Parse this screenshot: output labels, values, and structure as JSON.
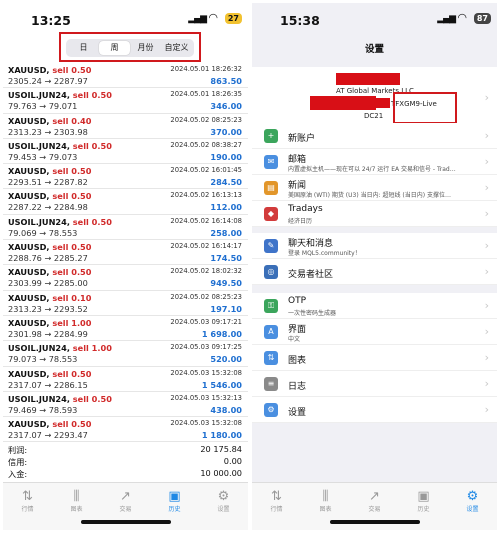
{
  "left": {
    "status": {
      "time": "13:25",
      "battery": "27"
    },
    "segments": [
      "日",
      "周",
      "月份",
      "自定义"
    ],
    "trades": [
      {
        "symbol": "XAUUSD,",
        "side": "sell 0.50",
        "datetime": "2024.05.01 18:26:32",
        "prices": "2305.24 → 2287.97",
        "profit": "863.50"
      },
      {
        "symbol": "USOIL.JUN24,",
        "side": "sell 0.50",
        "datetime": "2024.05.01 18:26:35",
        "prices": "79.763 → 79.071",
        "profit": "346.00"
      },
      {
        "symbol": "XAUUSD,",
        "side": "sell 0.40",
        "datetime": "2024.05.02 08:25:23",
        "prices": "2313.23 → 2303.98",
        "profit": "370.00"
      },
      {
        "symbol": "USOIL.JUN24,",
        "side": "sell 0.50",
        "datetime": "2024.05.02 08:38:27",
        "prices": "79.453 → 79.073",
        "profit": "190.00"
      },
      {
        "symbol": "XAUUSD,",
        "side": "sell 0.50",
        "datetime": "2024.05.02 16:01:45",
        "prices": "2293.51 → 2287.82",
        "profit": "284.50"
      },
      {
        "symbol": "XAUUSD,",
        "side": "sell 0.50",
        "datetime": "2024.05.02 16:13:13",
        "prices": "2287.22 → 2284.98",
        "profit": "112.00"
      },
      {
        "symbol": "USOIL.JUN24,",
        "side": "sell 0.50",
        "datetime": "2024.05.02 16:14:08",
        "prices": "79.069 → 78.553",
        "profit": "258.00"
      },
      {
        "symbol": "XAUUSD,",
        "side": "sell 0.50",
        "datetime": "2024.05.02 16:14:17",
        "prices": "2288.76 → 2285.27",
        "profit": "174.50"
      },
      {
        "symbol": "XAUUSD,",
        "side": "sell 0.50",
        "datetime": "2024.05.02 18:02:32",
        "prices": "2303.99 → 2285.00",
        "profit": "949.50"
      },
      {
        "symbol": "XAUUSD,",
        "side": "sell 0.10",
        "datetime": "2024.05.02 08:25:23",
        "prices": "2313.23 → 2293.52",
        "profit": "197.10"
      },
      {
        "symbol": "XAUUSD,",
        "side": "sell 1.00",
        "datetime": "2024.05.03 09:17:21",
        "prices": "2301.98 → 2284.99",
        "profit": "1 698.00"
      },
      {
        "symbol": "USOIL.JUN24,",
        "side": "sell 1.00",
        "datetime": "2024.05.03 09:17:25",
        "prices": "79.073 → 78.553",
        "profit": "520.00"
      },
      {
        "symbol": "XAUUSD,",
        "side": "sell 0.50",
        "datetime": "2024.05.03 15:32:08",
        "prices": "2317.07 → 2286.15",
        "profit": "1 546.00"
      },
      {
        "symbol": "USOIL.JUN24,",
        "side": "sell 0.50",
        "datetime": "2024.05.03 15:32:13",
        "prices": "79.469 → 78.593",
        "profit": "438.00"
      },
      {
        "symbol": "XAUUSD,",
        "side": "sell 0.50",
        "datetime": "2024.05.03 15:32:08",
        "prices": "2317.07 → 2293.47",
        "profit": "1 180.00"
      }
    ],
    "totals": [
      {
        "label": "利润:",
        "value": "20 175.84"
      },
      {
        "label": "信用:",
        "value": "0.00"
      },
      {
        "label": "入金:",
        "value": "10 000.00"
      }
    ]
  },
  "right": {
    "status": {
      "time": "15:38",
      "battery": "87"
    },
    "title": "设置",
    "account": {
      "broker": "AT Global Markets LLC",
      "server": "TFXGM9-Live",
      "id": "DC21"
    },
    "groups": [
      [
        {
          "label": "新账户",
          "sub": "",
          "icon": "new-account-icon",
          "color": "#3ba55c",
          "glyph": "+"
        },
        {
          "label": "邮箱",
          "sub": "内置虚拟主机——现在可以 24/7 运行 EA 交易和信号 - Trad…",
          "icon": "mail-icon",
          "color": "#4a8fe0",
          "glyph": "✉"
        },
        {
          "label": "新闻",
          "sub": "美国原油 (WTI) 期货 (U3) 当日内: 超短线 (当日内) 支撑位…",
          "icon": "news-icon",
          "color": "#e2962a",
          "glyph": "▤"
        },
        {
          "label": "Tradays",
          "sub": "经济日历",
          "icon": "tradays-icon",
          "color": "#d23b3b",
          "glyph": "◆"
        }
      ],
      [
        {
          "label": "聊天和消息",
          "sub": "登录 MQL5.community！",
          "icon": "chat-icon",
          "color": "#3f74c9",
          "glyph": "✎"
        },
        {
          "label": "交易者社区",
          "sub": "",
          "icon": "community-icon",
          "color": "#3a6fb8",
          "glyph": "◎"
        }
      ],
      [
        {
          "label": "OTP",
          "sub": "一次性密码生成器",
          "icon": "otp-icon",
          "color": "#3ba55c",
          "glyph": "⚿"
        },
        {
          "label": "界面",
          "sub": "中文",
          "icon": "interface-icon",
          "color": "#4a8fe0",
          "glyph": "A"
        },
        {
          "label": "图表",
          "sub": "",
          "icon": "charts-icon",
          "color": "#4a8fe0",
          "glyph": "⇅"
        },
        {
          "label": "日志",
          "sub": "",
          "icon": "journal-icon",
          "color": "#8a8a8a",
          "glyph": "≡"
        },
        {
          "label": "设置",
          "sub": "",
          "icon": "settings-icon",
          "color": "#4a8fe0",
          "glyph": "⚙"
        }
      ]
    ]
  },
  "tabs": [
    {
      "label": "行情",
      "icon": "quotes-icon",
      "glyph": "⇅"
    },
    {
      "label": "图表",
      "icon": "chart-icon",
      "glyph": "⫼"
    },
    {
      "label": "交易",
      "icon": "trade-icon",
      "glyph": "↗"
    },
    {
      "label": "历史",
      "icon": "history-icon",
      "glyph": "▣"
    },
    {
      "label": "设置",
      "icon": "settings-icon",
      "glyph": "⚙"
    }
  ],
  "colors": {
    "sell": "#d12a2a",
    "profit": "#1f6fd0",
    "active_tab": "#1e88e5",
    "highlight_box": "#d0191d",
    "redaction": "#d80f16"
  }
}
